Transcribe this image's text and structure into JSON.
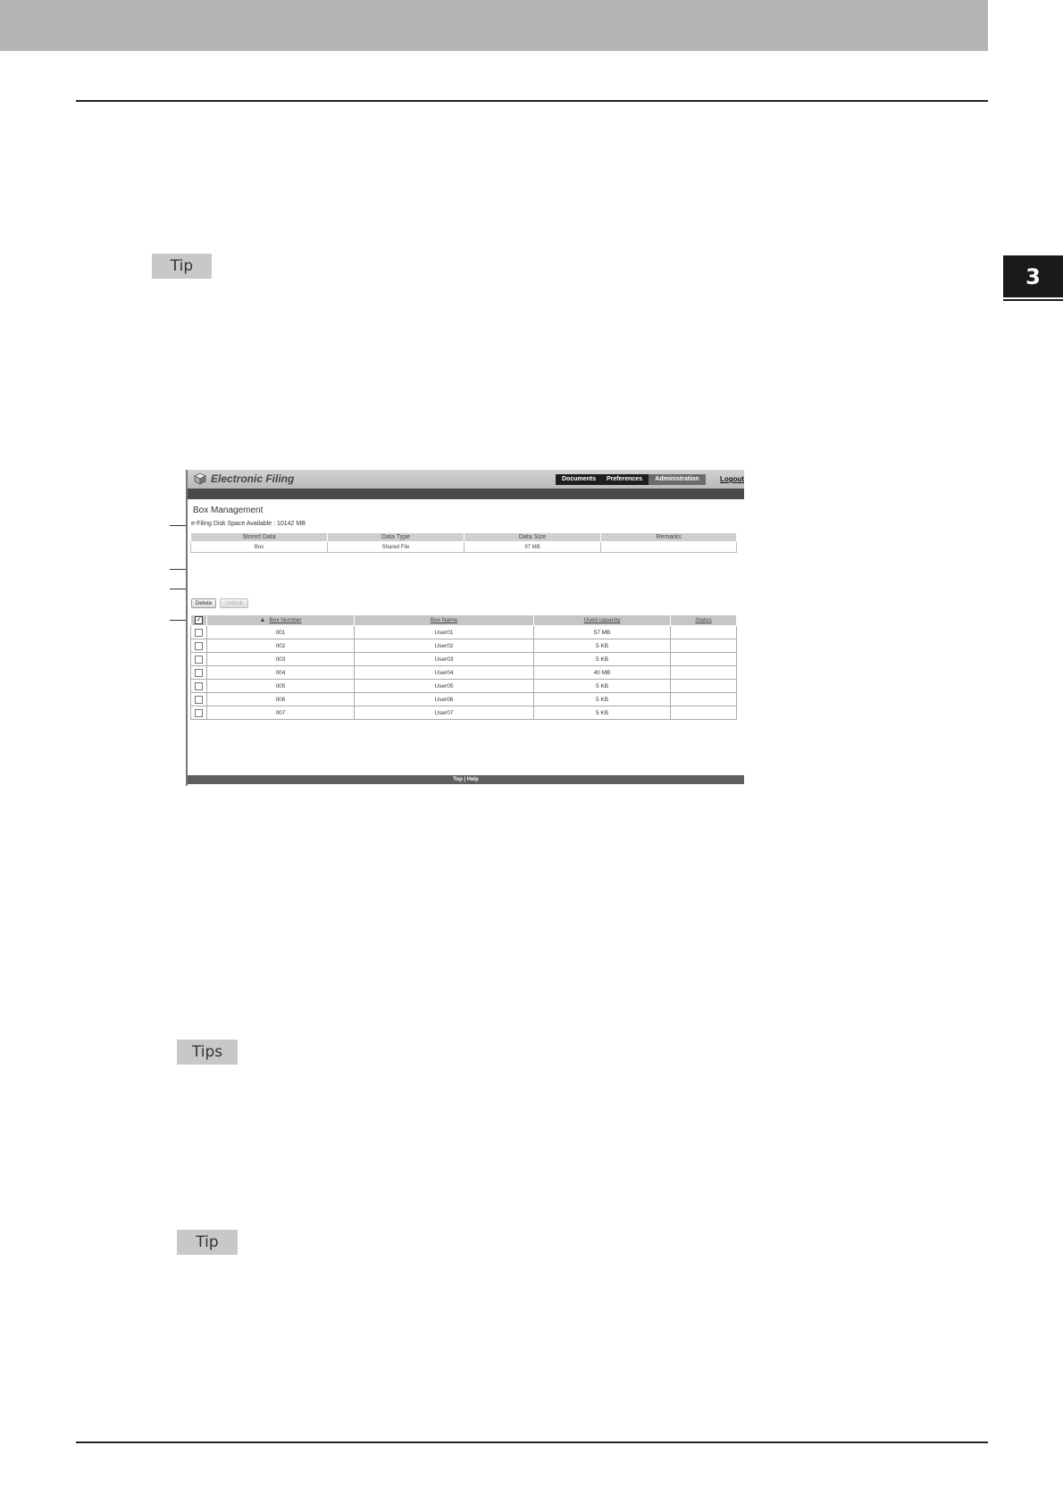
{
  "chapter": {
    "number": "3"
  },
  "tips": {
    "tip1": "Tip",
    "tips": "Tips",
    "tip2": "Tip"
  },
  "app": {
    "title": "Electronic Filing",
    "nav": [
      "Documents",
      "Preferences",
      "Administration"
    ],
    "nav_active": "Administration",
    "logout": "Logout",
    "footer": "Top | Help"
  },
  "box_management": {
    "title": "Box Management",
    "disk_space": "e-Filing Disk Space Available : 10142 MB",
    "stored_table": {
      "headers": [
        "Stored Data",
        "Data Type",
        "Data Size",
        "Remarks"
      ],
      "row": [
        "Box",
        "Shared File",
        "97 MB",
        ""
      ]
    },
    "buttons": {
      "delete": "Delete",
      "unlock": "Unlock"
    },
    "box_table": {
      "headers": [
        "Box Number",
        "Box Name",
        "Used capacity",
        "Status"
      ],
      "rows": [
        [
          "001",
          "User01",
          "57 MB",
          ""
        ],
        [
          "002",
          "User02",
          "5 KB",
          ""
        ],
        [
          "003",
          "User03",
          "5 KB",
          ""
        ],
        [
          "004",
          "User04",
          "40 MB",
          ""
        ],
        [
          "005",
          "User05",
          "5 KB",
          ""
        ],
        [
          "006",
          "User06",
          "5 KB",
          ""
        ],
        [
          "007",
          "User07",
          "5 KB",
          ""
        ]
      ]
    }
  }
}
